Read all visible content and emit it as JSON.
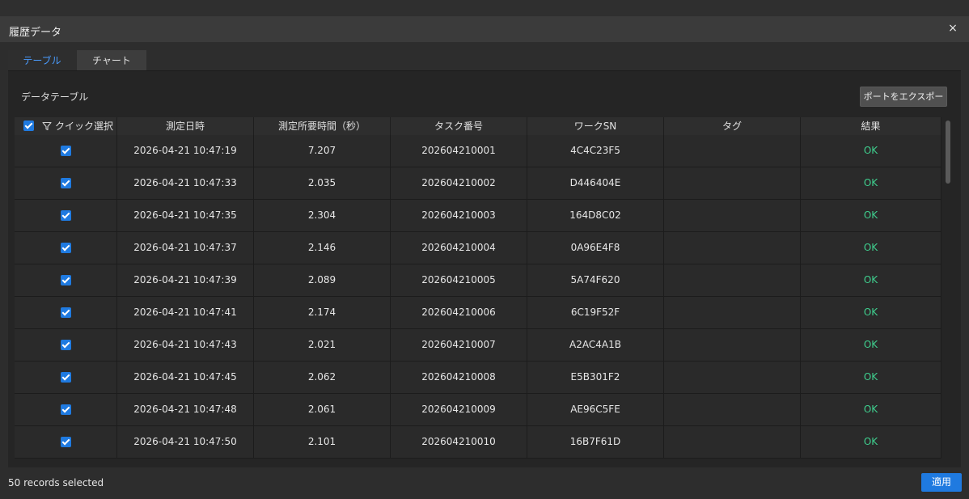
{
  "window": {
    "title": "履歴データ",
    "close_glyph": "×"
  },
  "tabs": [
    {
      "label": "テーブル",
      "active": true
    },
    {
      "label": "チャート",
      "active": false
    }
  ],
  "section": {
    "label": "データテーブル",
    "export_label": "ポートをエクスポー"
  },
  "table": {
    "headers": [
      "クイック選択",
      "測定日時",
      "測定所要時間（秒）",
      "タスク番号",
      "ワークSN",
      "タグ",
      "結果"
    ],
    "rows": [
      {
        "checked": true,
        "datetime": "2026-04-21 10:47:19",
        "duration": "7.207",
        "task": "202604210001",
        "sn": "4C4C23F5",
        "tag": "",
        "result": "OK"
      },
      {
        "checked": true,
        "datetime": "2026-04-21 10:47:33",
        "duration": "2.035",
        "task": "202604210002",
        "sn": "D446404E",
        "tag": "",
        "result": "OK"
      },
      {
        "checked": true,
        "datetime": "2026-04-21 10:47:35",
        "duration": "2.304",
        "task": "202604210003",
        "sn": "164D8C02",
        "tag": "",
        "result": "OK"
      },
      {
        "checked": true,
        "datetime": "2026-04-21 10:47:37",
        "duration": "2.146",
        "task": "202604210004",
        "sn": "0A96E4F8",
        "tag": "",
        "result": "OK"
      },
      {
        "checked": true,
        "datetime": "2026-04-21 10:47:39",
        "duration": "2.089",
        "task": "202604210005",
        "sn": "5A74F620",
        "tag": "",
        "result": "OK"
      },
      {
        "checked": true,
        "datetime": "2026-04-21 10:47:41",
        "duration": "2.174",
        "task": "202604210006",
        "sn": "6C19F52F",
        "tag": "",
        "result": "OK"
      },
      {
        "checked": true,
        "datetime": "2026-04-21 10:47:43",
        "duration": "2.021",
        "task": "202604210007",
        "sn": "A2AC4A1B",
        "tag": "",
        "result": "OK"
      },
      {
        "checked": true,
        "datetime": "2026-04-21 10:47:45",
        "duration": "2.062",
        "task": "202604210008",
        "sn": "E5B301F2",
        "tag": "",
        "result": "OK"
      },
      {
        "checked": true,
        "datetime": "2026-04-21 10:47:48",
        "duration": "2.061",
        "task": "202604210009",
        "sn": "AE96C5FE",
        "tag": "",
        "result": "OK"
      },
      {
        "checked": true,
        "datetime": "2026-04-21 10:47:50",
        "duration": "2.101",
        "task": "202604210010",
        "sn": "16B7F61D",
        "tag": "",
        "result": "OK"
      }
    ]
  },
  "footer": {
    "status": "50 records selected",
    "apply_label": "適用"
  },
  "icons": {
    "header_checkbox": "checkbox-checked-icon",
    "filter": "filter-icon",
    "close": "close-icon"
  },
  "colors": {
    "accent": "#1f7ae0",
    "tab_active": "#4a9cff",
    "ok": "#3fcf8e",
    "background": "#2d2d2d"
  }
}
